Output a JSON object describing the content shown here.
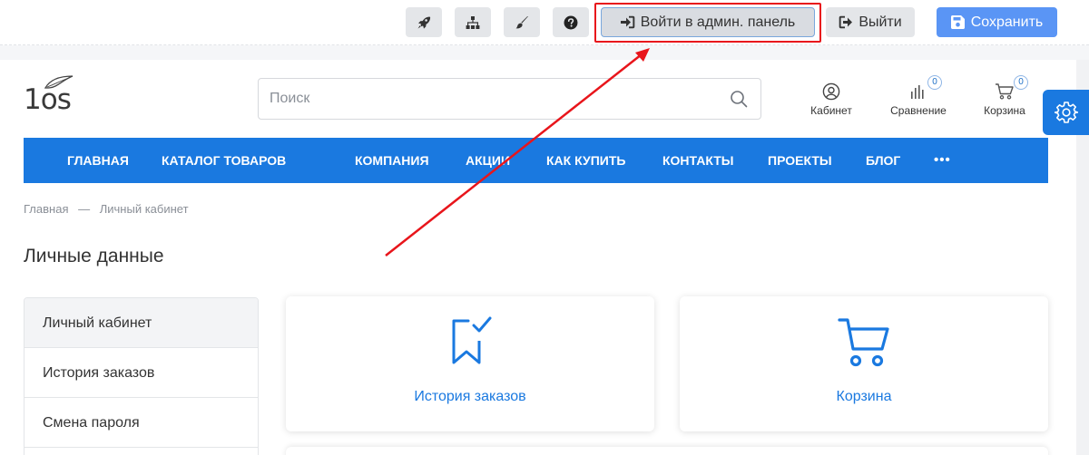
{
  "toolbar": {
    "icons": [
      "rocket-icon",
      "sitemap-icon",
      "brush-icon",
      "question-icon"
    ],
    "admin_label": "Войти в админ. панель",
    "exit_label": "Выйти",
    "save_label": "Сохранить",
    "save_color": "#5a95f5",
    "highlight_color": "#e8151b"
  },
  "header": {
    "logo_text": "1os",
    "search": {
      "placeholder": "Поиск",
      "value": ""
    },
    "cabinet_label": "Кабинет",
    "compare_label": "Сравнение",
    "compare_count": "0",
    "cart_label": "Корзина",
    "cart_count": "0"
  },
  "nav": {
    "accent": "#1a79e0",
    "items": [
      "ГЛАВНАЯ",
      "КАТАЛОГ ТОВАРОВ",
      "КОМПАНИЯ",
      "АКЦИИ",
      "КАК КУПИТЬ",
      "КОНТАКТЫ",
      "ПРОЕКТЫ",
      "БЛОГ"
    ],
    "more_label": "•••"
  },
  "breadcrumb": {
    "home": "Главная",
    "separator": "—",
    "current": "Личный кабинет"
  },
  "page_title": "Личные данные",
  "sidebar": {
    "items": [
      {
        "label": "Личный кабинет",
        "active": true
      },
      {
        "label": "История заказов",
        "active": false
      },
      {
        "label": "Смена пароля",
        "active": false
      }
    ]
  },
  "cards": [
    {
      "label": "История заказов",
      "icon": "bookmark-check-icon"
    },
    {
      "label": "Корзина",
      "icon": "cart-icon"
    }
  ]
}
